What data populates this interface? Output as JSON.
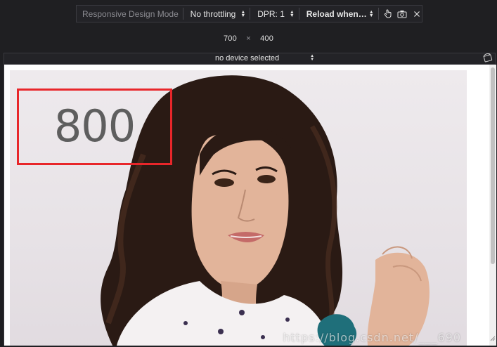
{
  "toolbar": {
    "title": "Responsive Design Mode",
    "throttling": "No throttling",
    "dpr": "DPR: 1",
    "reload": "Reload when…",
    "icons": [
      "touch-icon",
      "screenshot-icon",
      "close-icon"
    ]
  },
  "viewport_size": {
    "width": "700",
    "separator": "×",
    "height": "400"
  },
  "device": {
    "selected": "no device selected",
    "rotate_icon": "rotate-device-icon"
  },
  "page": {
    "counter_value": "800",
    "watermark": "https://blog.csdn.net/___690",
    "photo_description_icon": "portrait-photo"
  },
  "colors": {
    "chrome_bg": "#1f1f22",
    "toolbar_bg": "#232327",
    "box_border": "#e8262a",
    "counter_text": "#5e5e5e"
  }
}
